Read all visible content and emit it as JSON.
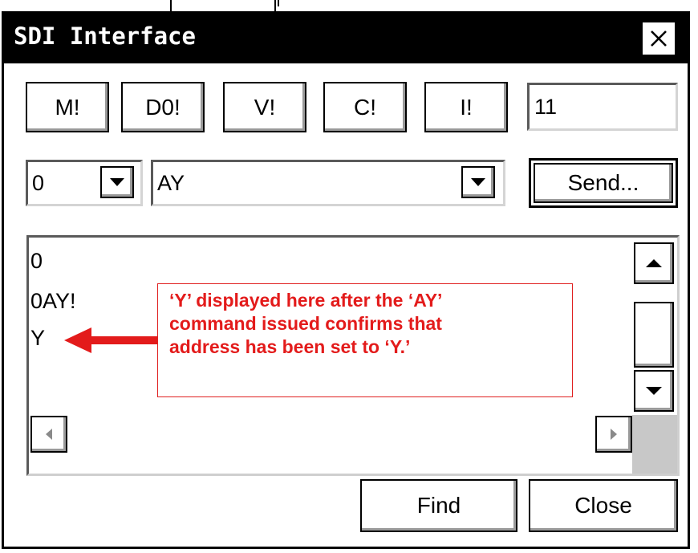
{
  "window": {
    "title": "SDI Interface",
    "close_glyph": "✕"
  },
  "command_buttons": [
    "M!",
    "D0!",
    "V!",
    "C!",
    "I!"
  ],
  "result_field": {
    "value": "11"
  },
  "address_select": {
    "value": "0"
  },
  "command_select": {
    "value": "AY"
  },
  "send_label": "Send...",
  "output_lines": [
    "0",
    "0AY!",
    "Y"
  ],
  "annotation": {
    "lines": [
      "‘Y’ displayed here after the ‘AY’",
      "command issued confirms that",
      "address has been set to ‘Y.’"
    ],
    "color": "#e31b1b"
  },
  "footer": {
    "find_label": "Find",
    "close_label": "Close"
  },
  "icons": {
    "dropdown": "chevron-down-icon",
    "scroll_up": "arrow-up-icon",
    "scroll_down": "arrow-down-icon",
    "scroll_left": "arrow-left-icon",
    "scroll_right": "arrow-right-icon",
    "close": "close-icon"
  }
}
